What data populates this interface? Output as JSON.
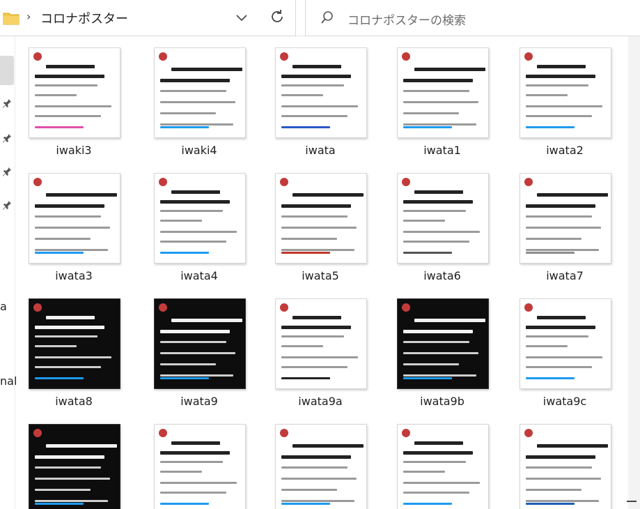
{
  "address_bar": {
    "folder_name": "コロナポスター"
  },
  "search": {
    "placeholder": "コロナポスターの検索"
  },
  "left_nav": {
    "fragments": [
      "a",
      "nal"
    ]
  },
  "files": [
    {
      "name": "iwaki3",
      "theme": "light",
      "accent": "#e24fa7"
    },
    {
      "name": "iwaki4",
      "theme": "light",
      "accent": "#1d9bf0"
    },
    {
      "name": "iwata",
      "theme": "light",
      "accent": "#2a57c9"
    },
    {
      "name": "iwata1",
      "theme": "light",
      "accent": "#1d9bf0"
    },
    {
      "name": "iwata2",
      "theme": "light",
      "accent": "#1d9bf0"
    },
    {
      "name": "iwata3",
      "theme": "light",
      "accent": "#1d9bf0"
    },
    {
      "name": "iwata4",
      "theme": "light",
      "accent": "#1d9bf0"
    },
    {
      "name": "iwata5",
      "theme": "light",
      "accent": "#c0392b"
    },
    {
      "name": "iwata6",
      "theme": "light",
      "accent": "#555555"
    },
    {
      "name": "iwata7",
      "theme": "light",
      "accent": "#8c8c8c"
    },
    {
      "name": "iwata8",
      "theme": "dark",
      "accent": "#1d9bf0"
    },
    {
      "name": "iwata9",
      "theme": "dark",
      "accent": "#1d9bf0"
    },
    {
      "name": "iwata9a",
      "theme": "light",
      "accent": "#222222"
    },
    {
      "name": "iwata9b",
      "theme": "dark",
      "accent": "#1d9bf0"
    },
    {
      "name": "iwata9c",
      "theme": "light",
      "accent": "#1d9bf0"
    },
    {
      "name": "",
      "theme": "dark",
      "accent": "#1d9bf0"
    },
    {
      "name": "",
      "theme": "light",
      "accent": "#1d9bf0"
    },
    {
      "name": "",
      "theme": "light",
      "accent": "#1d9bf0"
    },
    {
      "name": "",
      "theme": "light",
      "accent": "#1d9bf0"
    },
    {
      "name": "",
      "theme": "light",
      "accent": "#1e5fb4"
    }
  ],
  "colors": {
    "selection": "#dcdcdc",
    "folder": "#f2c94c",
    "pin": "#555555"
  },
  "icons": [
    "folder-icon",
    "chevron-right-icon",
    "chevron-down-icon",
    "refresh-icon",
    "search-icon",
    "pin-icon"
  ]
}
